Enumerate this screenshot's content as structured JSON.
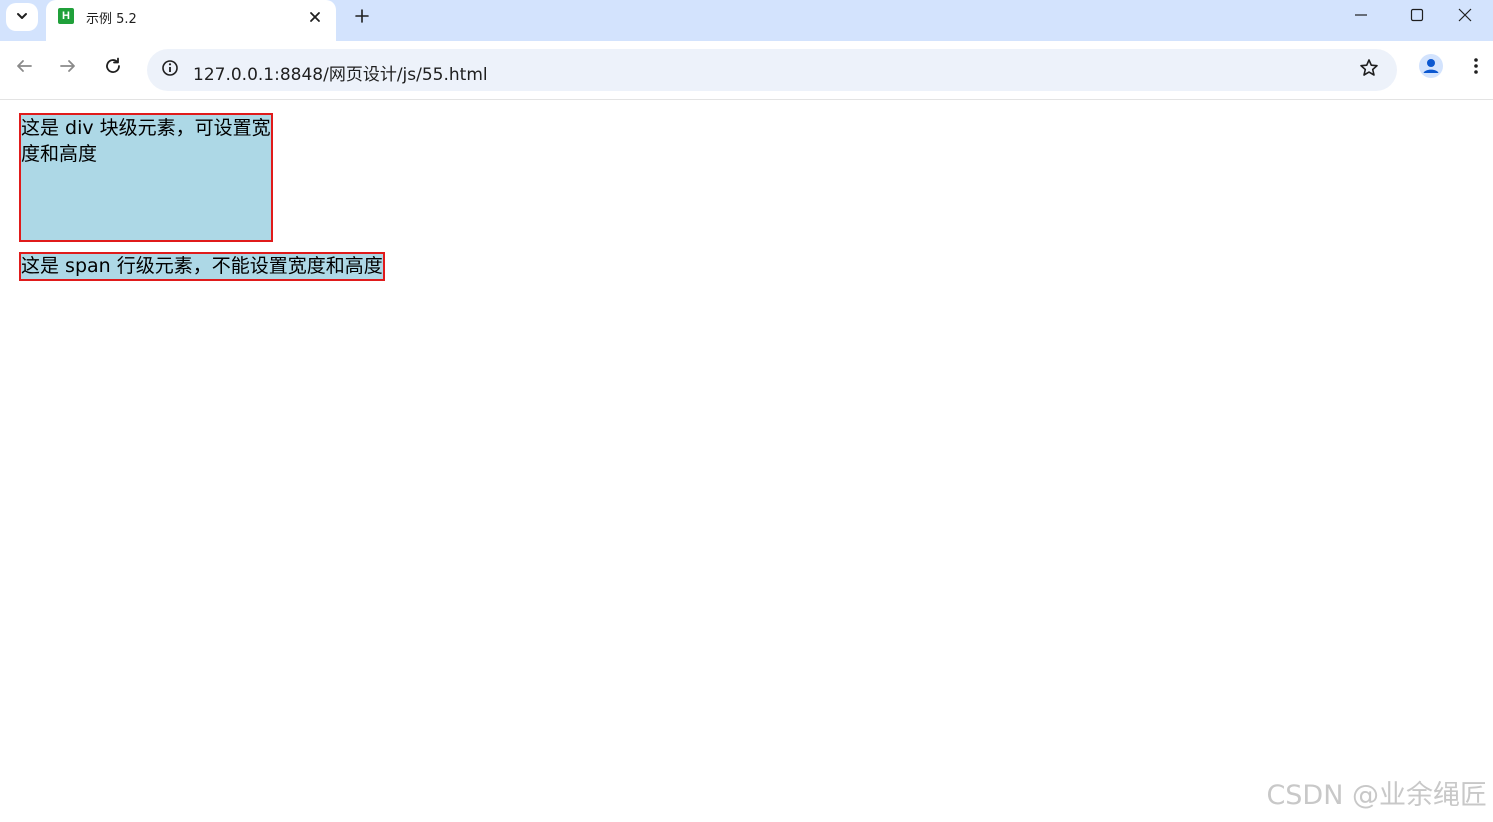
{
  "tab": {
    "title": "示例 5.2",
    "favicon_letter": "H",
    "favicon_color": "#20a03a"
  },
  "omnibox": {
    "url": "127.0.0.1:8848/网页设计/js/55.html"
  },
  "page": {
    "div_text": "这是 div 块级元素，可设置宽度和高度",
    "span_text": "这是 span 行级元素，不能设置宽度和高度",
    "box_background": "#add8e6",
    "box_border": "#e01b1b"
  },
  "watermark": "CSDN @业余绳匠",
  "icons": {
    "tab_search": "chevron-down-icon",
    "tab_close": "close-icon",
    "new_tab": "plus-icon",
    "minimize": "minimize-icon",
    "maximize": "maximize-icon",
    "close_window": "close-icon",
    "back": "back-arrow-icon",
    "forward": "forward-arrow-icon",
    "reload": "reload-icon",
    "site_info": "info-icon",
    "bookmark": "star-icon",
    "profile": "profile-icon",
    "menu": "kebab-menu-icon"
  }
}
